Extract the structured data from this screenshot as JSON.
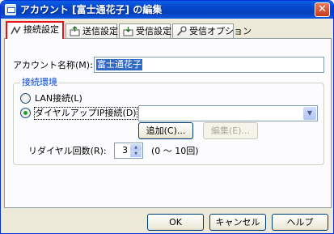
{
  "window": {
    "title": "アカウント [富士通花子] の編集",
    "close_glyph": "✕"
  },
  "tabs": [
    {
      "label": "接続設定",
      "icon": "connection-icon",
      "active": true
    },
    {
      "label": "送信設定",
      "icon": "send-icon",
      "active": false
    },
    {
      "label": "受信設定",
      "icon": "receive-icon",
      "active": false
    },
    {
      "label": "受信オプション",
      "icon": "receive-option-icon",
      "active": false
    }
  ],
  "account": {
    "label": "アカウント名称(M):",
    "value": "富士通花子"
  },
  "connection": {
    "group_title": "接続環境",
    "lan_label": "LAN接続(L)",
    "lan_selected": false,
    "dialup_label": "ダイヤルアップIP接続(D)",
    "dialup_selected": true,
    "dialup_combo_value": "",
    "add_button": "追加(C)...",
    "edit_button": "編集(E)...",
    "redial_label": "リダイヤル回数(R):",
    "redial_value": "3",
    "redial_range": "(0 ～ 10回)"
  },
  "footer": {
    "ok": "OK",
    "cancel": "キャンセル",
    "help": "ヘルプ"
  },
  "colors": {
    "active_tab_border": "#e3141b",
    "titlebar": "#0846c8",
    "selection": "#316ac5",
    "radio_dot": "#21a121"
  }
}
